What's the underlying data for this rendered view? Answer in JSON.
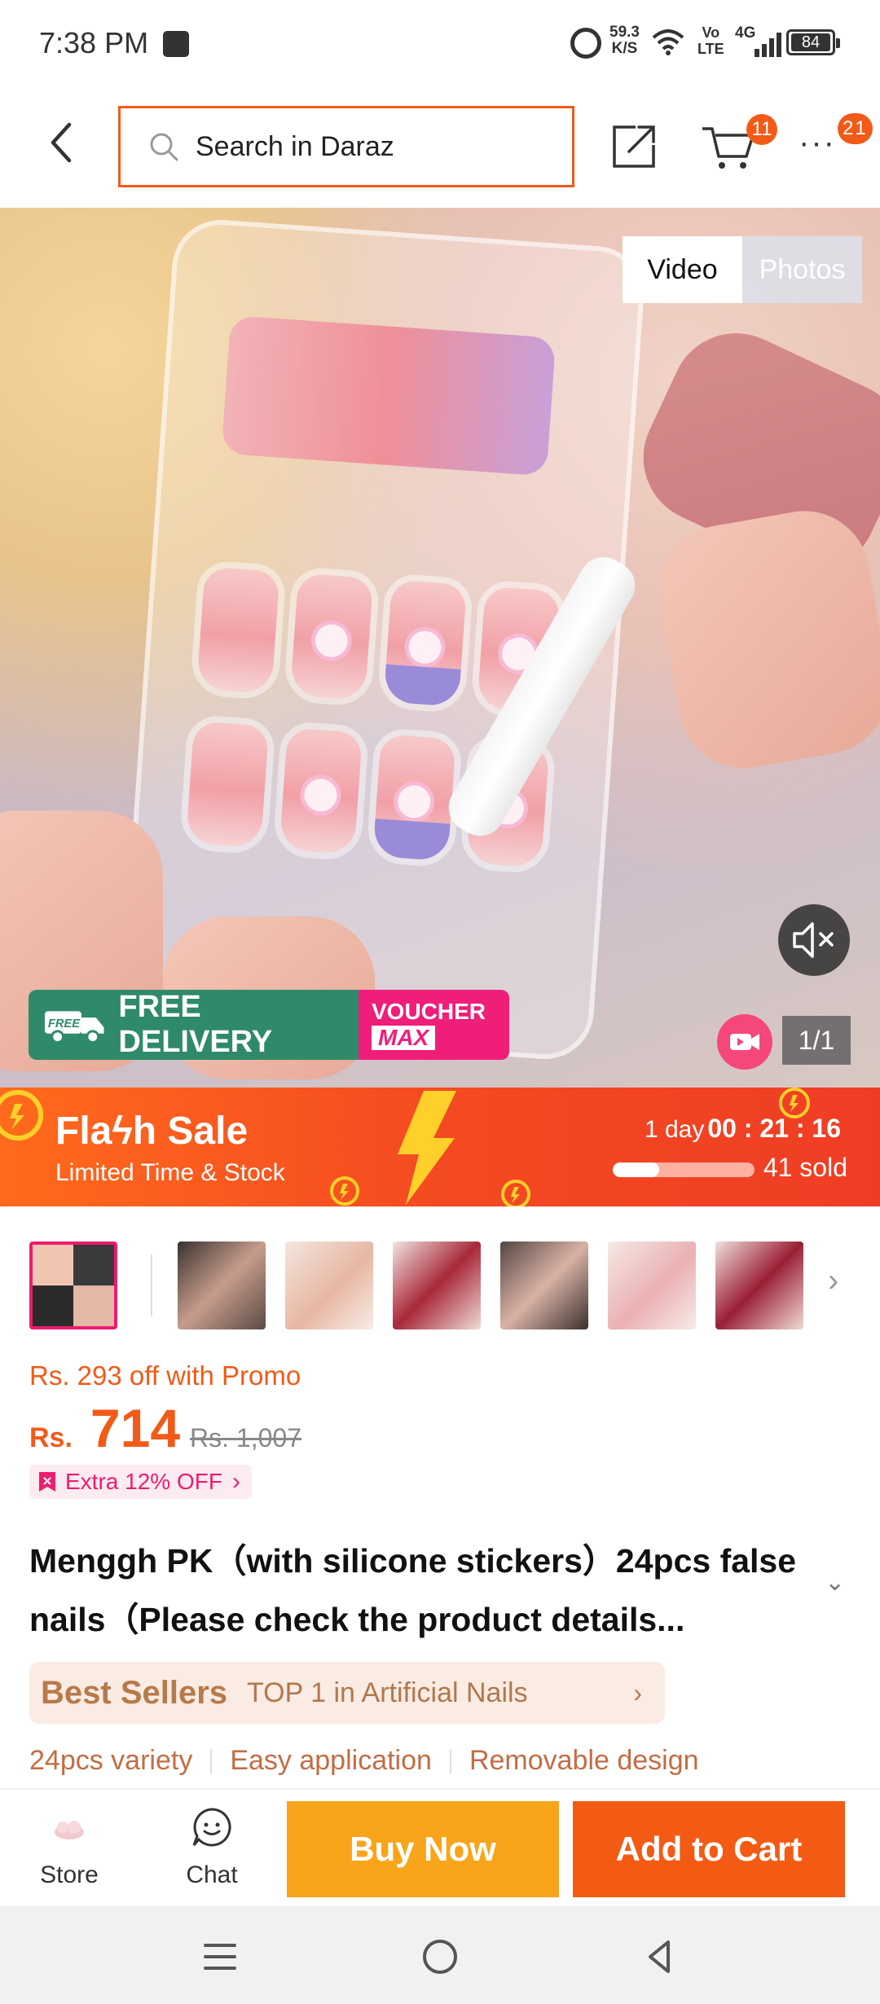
{
  "status_bar": {
    "time": "7:38 PM",
    "net_speed_value": "59.3",
    "net_speed_unit": "K/S",
    "volte_top": "Vo",
    "volte_bottom": "LTE",
    "network": "4G",
    "battery": "84"
  },
  "header": {
    "search_placeholder": "Search in Daraz",
    "cart_count": "11",
    "more_count": "21"
  },
  "media": {
    "tab_video": "Video",
    "tab_photos": "Photos",
    "free_delivery_tag": "FREE",
    "free_delivery": "FREE DELIVERY",
    "voucher_line1": "VOUCHER",
    "voucher_line2": "MAX",
    "counter": "1/1"
  },
  "flash_sale": {
    "title": "Flaϟh Sale",
    "subtitle": "Limited Time & Stock",
    "timer_days": "1 day",
    "timer_clock": "00 : 21 : 16",
    "sold": "41 sold",
    "sold_progress": 0.33
  },
  "thumbnails": {
    "count": 7,
    "selected_index": 0
  },
  "price": {
    "promo": "Rs. 293 off with Promo",
    "currency": "Rs.",
    "current": "714",
    "original": "Rs. 1,007",
    "extra_off": "Extra 12% OFF"
  },
  "product": {
    "title": "Menggh PK（with silicone stickers）24pcs false nails（Please check the product details...",
    "best_sellers_label": "Best Sellers",
    "best_sellers_rank": "TOP 1 in Artificial Nails",
    "features": [
      "24pcs variety",
      "Easy application",
      "Removable design"
    ]
  },
  "bottom_bar": {
    "store_label": "Store",
    "chat_label": "Chat",
    "buy_now": "Buy Now",
    "add_to_cart": "Add to Cart"
  },
  "colors": {
    "brand_orange": "#f25a18",
    "buy_now": "#f8a51b",
    "add_to_cart": "#f35b15",
    "voucher_pink": "#ef1e79",
    "free_delivery_green": "#2f8a69"
  }
}
